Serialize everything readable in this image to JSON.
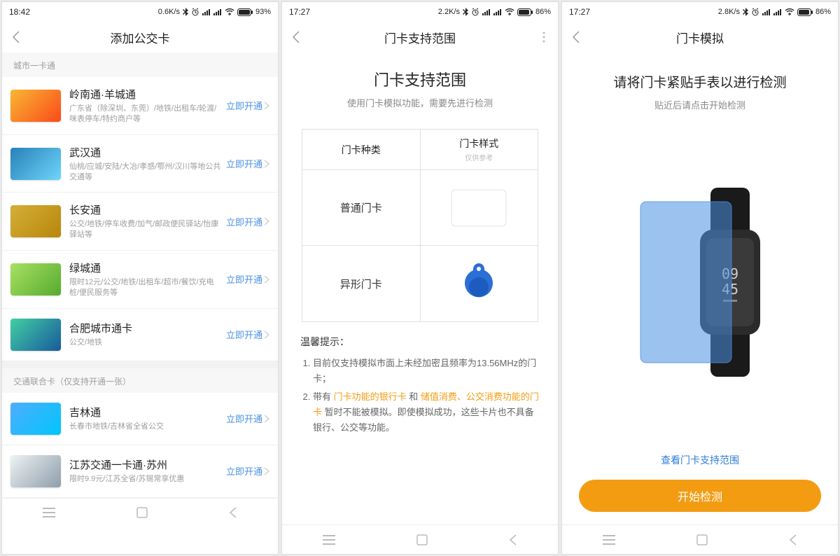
{
  "phone1": {
    "status": {
      "time": "18:42",
      "speed": "0.6K/s",
      "battery": "93%"
    },
    "title": "添加公交卡",
    "section1_label": "城市一卡通",
    "cards1": [
      {
        "name": "岭南通·羊城通",
        "desc": "广东省（除深圳、东莞）/地铁/出租车/轮渡/咪表停车/特约商户等",
        "action": "立即开通"
      },
      {
        "name": "武汉通",
        "desc": "仙桃/应城/安陆/大冶/孝感/鄂州/汉川等地公共交通等",
        "action": "立即开通"
      },
      {
        "name": "长安通",
        "desc": "公交/地铁/停车收费/加气/邮政便民驿站/怡康驿站等",
        "action": "立即开通"
      },
      {
        "name": "绿城通",
        "desc": "限时12元/公交/地铁/出租车/超市/餐饮/充电桩/便民服务等",
        "action": "立即开通"
      },
      {
        "name": "合肥城市通卡",
        "desc": "公交/地铁",
        "action": "立即开通"
      }
    ],
    "section2_label": "交通联合卡（仅支持开通一张）",
    "cards2": [
      {
        "name": "吉林通",
        "desc": "长春市地铁/吉林省全省公交",
        "action": "立即开通"
      },
      {
        "name": "江苏交通一卡通·苏州",
        "desc": "限时9.9元/江苏全省/苏锡常享优惠",
        "action": "立即开通"
      }
    ]
  },
  "phone2": {
    "status": {
      "time": "17:27",
      "speed": "2.2K/s",
      "battery": "86%"
    },
    "title": "门卡支持范围",
    "hero_title": "门卡支持范围",
    "hero_sub": "使用门卡模拟功能，需要先进行检测",
    "col1": "门卡种类",
    "col2": "门卡样式",
    "col2_sub": "仅供参考",
    "row1": "普通门卡",
    "row2": "异形门卡",
    "tips_label": "温馨提示：",
    "tip1": "目前仅支持模拟市面上未经加密且频率为13.56MHz的门卡；",
    "tip2_a": "带有 ",
    "tip2_hl1": "门卡功能的银行卡",
    "tip2_b": " 和 ",
    "tip2_hl2": "储值消费、公交消费功能的门卡",
    "tip2_c": " 暂时不能被模拟。即使模拟成功，这些卡片也不具备银行、公交等功能。"
  },
  "phone3": {
    "status": {
      "time": "17:27",
      "speed": "2.8K/s",
      "battery": "86%"
    },
    "title": "门卡模拟",
    "hero_title": "请将门卡紧贴手表以进行检测",
    "hero_sub": "贴近后请点击开始检测",
    "watch_time": "09\n45",
    "link": "查看门卡支持范围",
    "button": "开始检测"
  },
  "card_colors": [
    "linear-gradient(135deg,#f7b733,#fc4a1a)",
    "linear-gradient(135deg,#2980b9,#6dd5fa)",
    "linear-gradient(135deg,#d4af37,#b8860b)",
    "linear-gradient(135deg,#a8e063,#56ab2f)",
    "linear-gradient(135deg,#43cea2,#185a9d)",
    "linear-gradient(135deg,#4facfe,#00c6fb)",
    "linear-gradient(135deg,#eef2f3,#8e9eab)"
  ]
}
